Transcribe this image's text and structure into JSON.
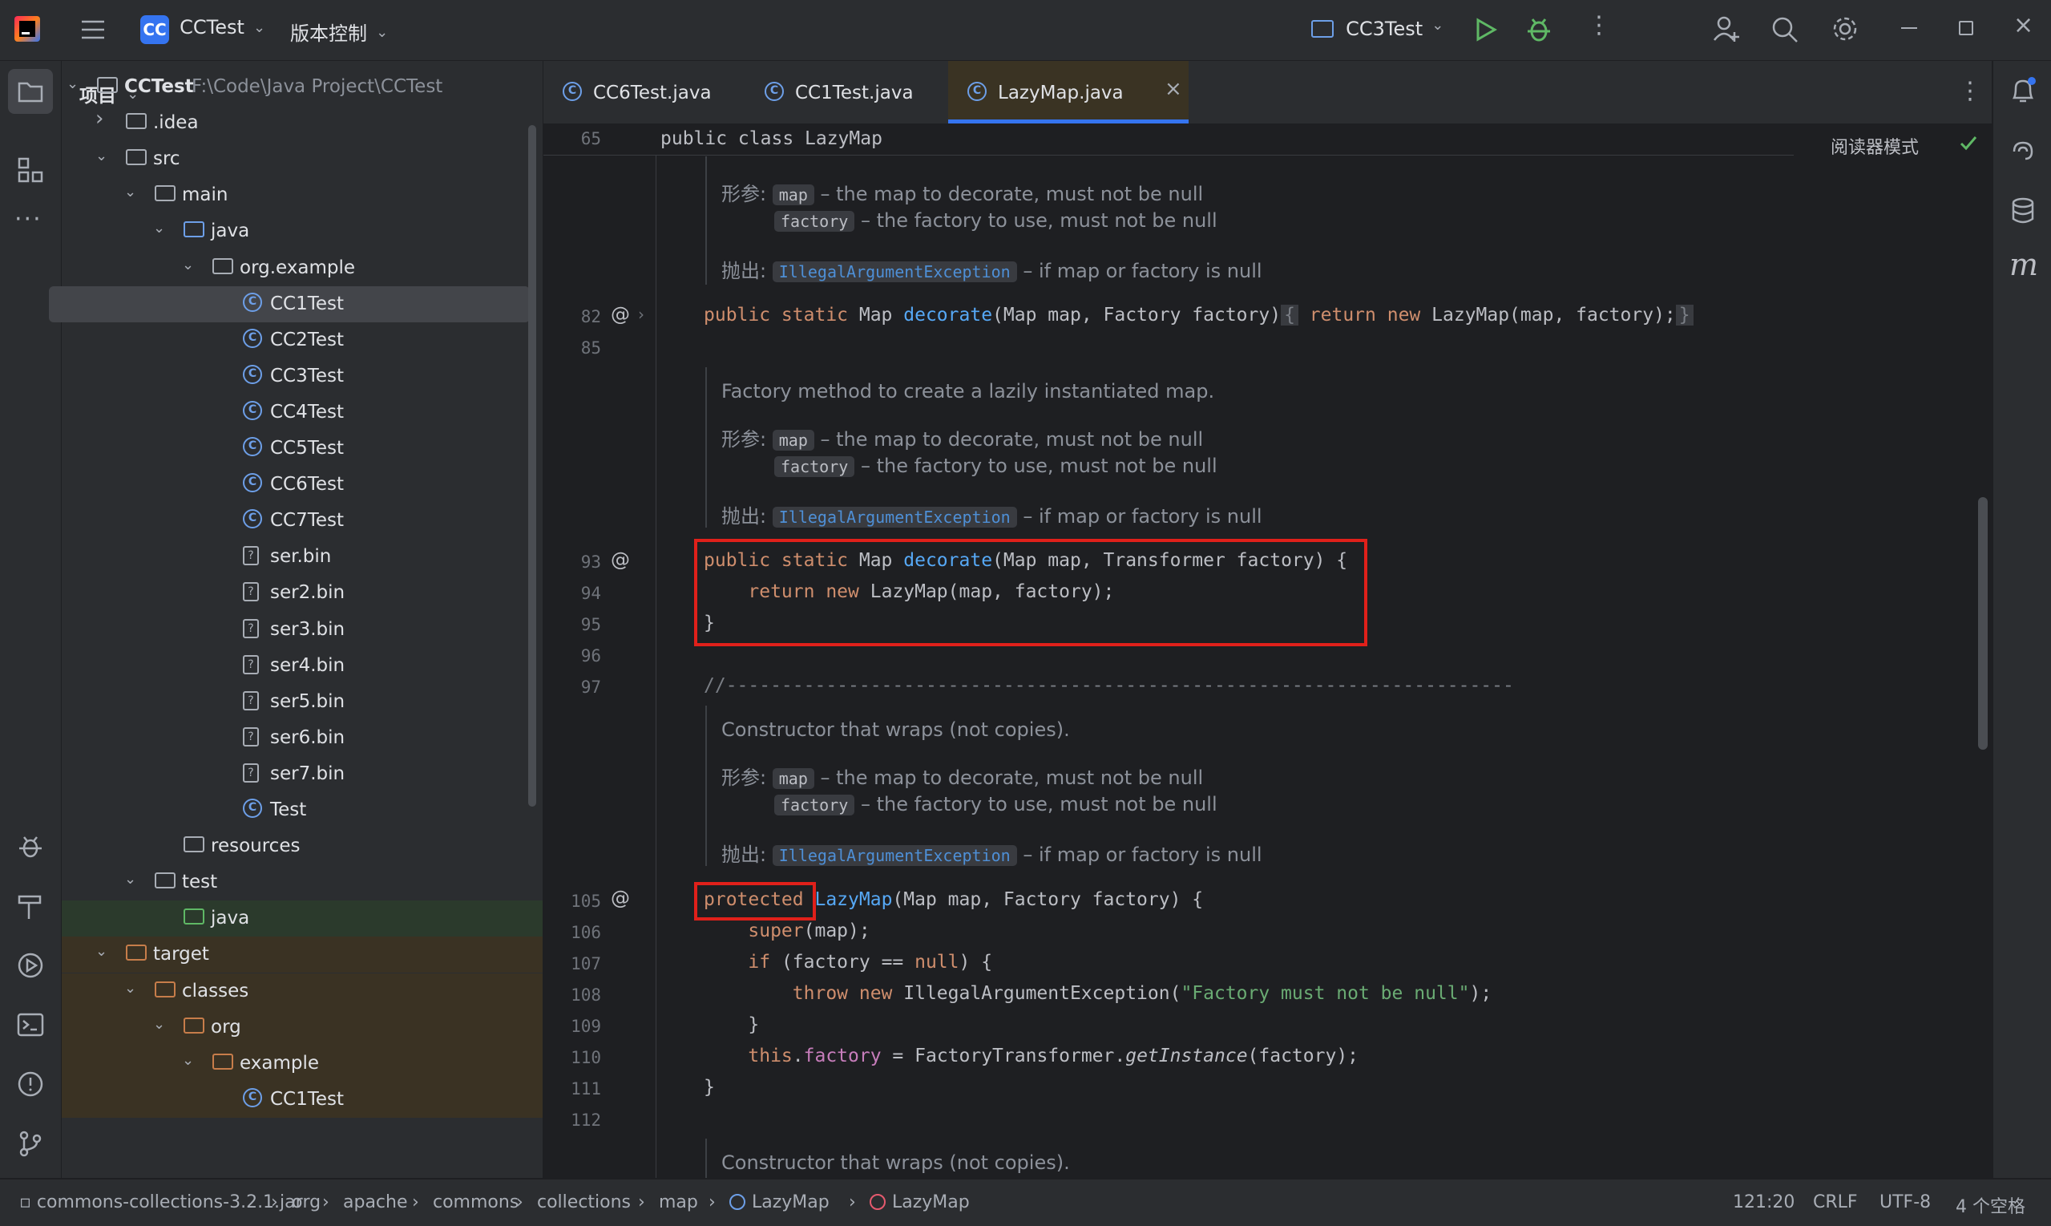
{
  "titlebar": {
    "project_badge": "CC",
    "project_name": "CCTest",
    "vcs_menu": "版本控制",
    "run_config": "CC3Test"
  },
  "project_panel": {
    "title": "项目",
    "tree": [
      {
        "label": "CCTest",
        "path": "F:\\Code\\Java Project\\CCTest",
        "type": "module",
        "depth": 0,
        "expanded": true
      },
      {
        "label": ".idea",
        "type": "folder",
        "depth": 1,
        "expanded": false
      },
      {
        "label": "src",
        "type": "folder",
        "depth": 1,
        "expanded": true
      },
      {
        "label": "main",
        "type": "folder",
        "depth": 2,
        "expanded": true
      },
      {
        "label": "java",
        "type": "folder-blue",
        "depth": 3,
        "expanded": true
      },
      {
        "label": "org.example",
        "type": "package",
        "depth": 4,
        "expanded": true
      },
      {
        "label": "CC1Test",
        "type": "class",
        "depth": 5,
        "selected": true
      },
      {
        "label": "CC2Test",
        "type": "class",
        "depth": 5
      },
      {
        "label": "CC3Test",
        "type": "class",
        "depth": 5
      },
      {
        "label": "CC4Test",
        "type": "class",
        "depth": 5
      },
      {
        "label": "CC5Test",
        "type": "class",
        "depth": 5
      },
      {
        "label": "CC6Test",
        "type": "class",
        "depth": 5
      },
      {
        "label": "CC7Test",
        "type": "class",
        "depth": 5
      },
      {
        "label": "ser.bin",
        "type": "file",
        "depth": 5
      },
      {
        "label": "ser2.bin",
        "type": "file",
        "depth": 5
      },
      {
        "label": "ser3.bin",
        "type": "file",
        "depth": 5
      },
      {
        "label": "ser4.bin",
        "type": "file",
        "depth": 5
      },
      {
        "label": "ser5.bin",
        "type": "file",
        "depth": 5
      },
      {
        "label": "ser6.bin",
        "type": "file",
        "depth": 5
      },
      {
        "label": "ser7.bin",
        "type": "file",
        "depth": 5
      },
      {
        "label": "Test",
        "type": "class",
        "depth": 5
      },
      {
        "label": "resources",
        "type": "folder-res",
        "depth": 3
      },
      {
        "label": "test",
        "type": "folder",
        "depth": 2,
        "expanded": true
      },
      {
        "label": "java",
        "type": "folder-green",
        "depth": 3
      },
      {
        "label": "target",
        "type": "folder-orange",
        "depth": 1,
        "expanded": true
      },
      {
        "label": "classes",
        "type": "folder-orange",
        "depth": 2,
        "expanded": true
      },
      {
        "label": "org",
        "type": "folder-orange",
        "depth": 3,
        "expanded": true
      },
      {
        "label": "example",
        "type": "folder-orange",
        "depth": 4,
        "expanded": true
      },
      {
        "label": "CC1Test",
        "type": "class",
        "depth": 5
      }
    ]
  },
  "tabs": [
    {
      "label": "CC6Test.java",
      "active": false
    },
    {
      "label": "CC1Test.java",
      "active": false
    },
    {
      "label": "LazyMap.java",
      "active": true
    }
  ],
  "editor": {
    "reader_mode": "阅读器模式",
    "sticky_line_number": "65",
    "sticky_line": "public class LazyMap",
    "doc_params_label": "形参:",
    "doc_throws_label": "抛出:",
    "param_map": "map",
    "param_factory": "factory",
    "param_map_desc": "– the map to decorate, must not be null",
    "param_factory_desc": "– the factory to use, must not be null",
    "exception": "IllegalArgumentException",
    "exception_desc": "– if map or factory is null",
    "doc_factory_method": "Factory method to create a lazily instantiated map.",
    "doc_constructor": "Constructor that wraps (not copies).",
    "line_numbers": [
      "82",
      "85",
      "93",
      "94",
      "95",
      "96",
      "97",
      "105",
      "106",
      "107",
      "108",
      "109",
      "110",
      "111",
      "112"
    ],
    "separator_comment": "//-----------------------------------------------------------------------",
    "exception_message": "\"Factory must not be null\""
  },
  "breadcrumb": [
    "commons-collections-3.2.1.jar",
    "org",
    "apache",
    "commons",
    "collections",
    "map",
    "LazyMap",
    "LazyMap"
  ],
  "status": {
    "position": "121:20",
    "line_sep": "CRLF",
    "encoding": "UTF-8",
    "indent": "4 个空格"
  },
  "colors": {
    "accent": "#3574f0",
    "highlight_box": "#e0201a",
    "keyword": "#cf8e6d",
    "function": "#56a8f5"
  }
}
